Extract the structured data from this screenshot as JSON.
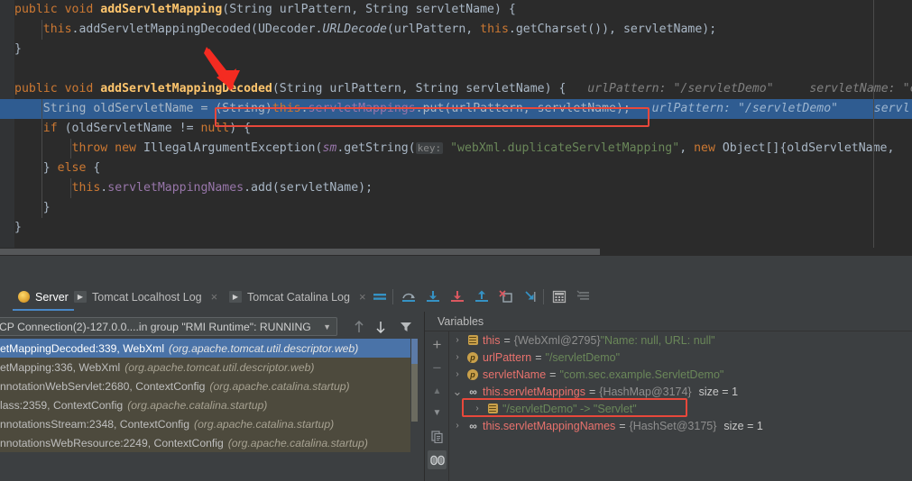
{
  "editor": {
    "lines": [
      {
        "id": "line-1",
        "tokens": [
          {
            "t": "public ",
            "c": "kw"
          },
          {
            "t": "void ",
            "c": "kw"
          },
          {
            "t": "addServletMapping",
            "c": "fn"
          },
          {
            "t": "(",
            "c": "plain"
          },
          {
            "t": "String",
            "c": "plain"
          },
          {
            "t": " urlPattern, ",
            "c": "plain"
          },
          {
            "t": "String",
            "c": "plain"
          },
          {
            "t": " servletName) {",
            "c": "plain"
          }
        ],
        "indent": 1
      },
      {
        "id": "line-2",
        "tokens": [
          {
            "t": "    ",
            "c": "plain"
          },
          {
            "t": "this",
            "c": "kw"
          },
          {
            "t": ".",
            "c": "plain"
          },
          {
            "t": "addServletMappingDecoded",
            "c": "plain"
          },
          {
            "t": "(UDecoder.",
            "c": "plain"
          },
          {
            "t": "URLDecode",
            "c": "static-it"
          },
          {
            "t": "(urlPattern, ",
            "c": "plain"
          },
          {
            "t": "this",
            "c": "kw"
          },
          {
            "t": ".getCharset()), servletName);",
            "c": "plain"
          }
        ],
        "indent": 2
      },
      {
        "id": "line-3",
        "tokens": [
          {
            "t": "}",
            "c": "plain"
          }
        ],
        "indent": 1
      },
      {
        "id": "line-4",
        "tokens": [
          {
            "t": "",
            "c": "plain"
          }
        ],
        "indent": 0
      },
      {
        "id": "line-5",
        "tokens": [
          {
            "t": "public ",
            "c": "kw"
          },
          {
            "t": "void ",
            "c": "kw"
          },
          {
            "t": "addServletMappingDecoded",
            "c": "fn"
          },
          {
            "t": "(",
            "c": "plain"
          },
          {
            "t": "String",
            "c": "plain"
          },
          {
            "t": " urlPattern, ",
            "c": "plain"
          },
          {
            "t": "String",
            "c": "plain"
          },
          {
            "t": " servletName) {",
            "c": "plain"
          },
          {
            "t": "   urlPattern: ",
            "c": "hint"
          },
          {
            "t": "\"/servletDemo\"",
            "c": "hint"
          },
          {
            "t": "     servletName: ",
            "c": "hint"
          },
          {
            "t": "\"c",
            "c": "hint"
          }
        ],
        "indent": 1
      },
      {
        "id": "line-6-current",
        "current": true,
        "tokens": [
          {
            "t": "    ",
            "c": "plain"
          },
          {
            "t": "String",
            "c": "plain"
          },
          {
            "t": " oldServletName = ",
            "c": "plain"
          },
          {
            "t": "(String)",
            "c": "plain"
          },
          {
            "t": "this",
            "c": "kw"
          },
          {
            "t": ".",
            "c": "plain"
          },
          {
            "t": "servletMappings",
            "c": "field"
          },
          {
            "t": ".put(urlPattern, servletName);",
            "c": "plain"
          },
          {
            "t": "   urlPattern: ",
            "c": "hint"
          },
          {
            "t": "\"/servletDemo\"",
            "c": "hint"
          },
          {
            "t": "     servl",
            "c": "hint"
          }
        ],
        "indent": 2
      },
      {
        "id": "line-7",
        "tokens": [
          {
            "t": "    ",
            "c": "plain"
          },
          {
            "t": "if",
            "c": "kw"
          },
          {
            "t": " (oldServletName != ",
            "c": "plain"
          },
          {
            "t": "null",
            "c": "kw"
          },
          {
            "t": ") {",
            "c": "plain"
          }
        ],
        "indent": 2
      },
      {
        "id": "line-8",
        "tokens": [
          {
            "t": "        ",
            "c": "plain"
          },
          {
            "t": "throw ",
            "c": "kw"
          },
          {
            "t": "new ",
            "c": "kw"
          },
          {
            "t": "IllegalArgumentException(",
            "c": "plain"
          },
          {
            "t": "sm",
            "c": "field-it"
          },
          {
            "t": ".getString(",
            "c": "plain"
          },
          {
            "t": "KEYHINT",
            "c": "keyhint-marker"
          },
          {
            "t": " \"webXml.duplicateServletMapping\"",
            "c": "str"
          },
          {
            "t": ", ",
            "c": "plain"
          },
          {
            "t": "new ",
            "c": "kw"
          },
          {
            "t": "Object[]{oldServletName,",
            "c": "plain"
          }
        ],
        "indent": 3
      },
      {
        "id": "line-9",
        "tokens": [
          {
            "t": "    } ",
            "c": "plain"
          },
          {
            "t": "else",
            "c": "kw"
          },
          {
            "t": " {",
            "c": "plain"
          }
        ],
        "indent": 2
      },
      {
        "id": "line-10",
        "tokens": [
          {
            "t": "        ",
            "c": "plain"
          },
          {
            "t": "this",
            "c": "kw"
          },
          {
            "t": ".",
            "c": "plain"
          },
          {
            "t": "servletMappingNames",
            "c": "field"
          },
          {
            "t": ".add(servletName);",
            "c": "plain"
          }
        ],
        "indent": 3
      },
      {
        "id": "line-11",
        "tokens": [
          {
            "t": "    }",
            "c": "plain"
          }
        ],
        "indent": 2
      },
      {
        "id": "line-12",
        "tokens": [
          {
            "t": "}",
            "c": "plain"
          }
        ],
        "indent": 1
      }
    ],
    "key_hint_label": "key:",
    "annotation": {
      "arrow_name": "red-annotation-arrow",
      "box_color": "#e8483b"
    }
  },
  "toolwindow": {
    "tabs": [
      {
        "id": "tab-server",
        "label": "Server",
        "icon": "tomcat-icon",
        "selected": true,
        "closable": false
      },
      {
        "id": "tab-tomcat-localhost-log",
        "label": "Tomcat Localhost Log",
        "icon": "run-icon",
        "selected": false,
        "closable": true
      },
      {
        "id": "tab-tomcat-catalina-log",
        "label": "Tomcat Catalina Log",
        "icon": "run-icon",
        "selected": false,
        "closable": true
      }
    ],
    "close_label": "×",
    "toolbar": [
      {
        "id": "show-execution-point-button",
        "icon": "show-execution-point-icon",
        "title": "Show Execution Point"
      },
      {
        "id": "step-over-button",
        "icon": "step-over-icon",
        "title": "Step Over"
      },
      {
        "id": "step-into-button",
        "icon": "step-into-icon",
        "title": "Step Into"
      },
      {
        "id": "force-step-into-button",
        "icon": "force-step-into-icon",
        "title": "Force Step Into"
      },
      {
        "id": "step-out-button",
        "icon": "step-out-icon",
        "title": "Step Out"
      },
      {
        "id": "drop-frame-button",
        "icon": "drop-frame-icon",
        "title": "Drop Frame"
      },
      {
        "id": "run-to-cursor-button",
        "icon": "run-to-cursor-icon",
        "title": "Run to Cursor"
      },
      {
        "id": "evaluate-expression-button",
        "icon": "calculator-icon",
        "title": "Evaluate Expression"
      },
      {
        "id": "mute-breakpoints-button",
        "icon": "mute-breakpoints-icon",
        "title": "Mute Breakpoints"
      }
    ]
  },
  "frames_pane": {
    "thread_selector": {
      "value": "CP Connection(2)-127.0.0....in group \"RMI Runtime\": RUNNING",
      "caret": "▼"
    },
    "buttons": [
      {
        "id": "frames-up-button",
        "icon": "arrow-up-icon",
        "glyph": "↑"
      },
      {
        "id": "frames-down-button",
        "icon": "arrow-down-icon",
        "glyph": "↓"
      },
      {
        "id": "frames-filter-button",
        "icon": "filter-icon",
        "glyph": "▼"
      }
    ],
    "frames": [
      {
        "id": "frame-0",
        "text": "etMappingDecoded:339, WebXml",
        "pkg": "(org.apache.tomcat.util.descriptor.web)",
        "state": "selected"
      },
      {
        "id": "frame-1",
        "text": "etMapping:336, WebXml",
        "pkg": "(org.apache.tomcat.util.descriptor.web)",
        "state": "context"
      },
      {
        "id": "frame-2",
        "text": "nnotationWebServlet:2680, ContextConfig",
        "pkg": "(org.apache.catalina.startup)",
        "state": "context"
      },
      {
        "id": "frame-3",
        "text": "lass:2359, ContextConfig",
        "pkg": "(org.apache.catalina.startup)",
        "state": "context"
      },
      {
        "id": "frame-4",
        "text": "nnotationsStream:2348, ContextConfig",
        "pkg": "(org.apache.catalina.startup)",
        "state": "context"
      },
      {
        "id": "frame-5",
        "text": "nnotationsWebResource:2249, ContextConfig",
        "pkg": "(org.apache.catalina.startup)",
        "state": "context"
      }
    ]
  },
  "variables_pane": {
    "title": "Variables",
    "left_toolbar": [
      {
        "id": "add-watch-button",
        "icon": "plus-icon",
        "glyph": "+",
        "active": false
      },
      {
        "id": "remove-watch-button",
        "icon": "minus-icon",
        "glyph": "−",
        "active": false
      },
      {
        "id": "move-watch-up-button",
        "icon": "triangle-up-icon",
        "glyph": "▲",
        "active": false
      },
      {
        "id": "move-watch-down-button",
        "icon": "triangle-down-icon",
        "glyph": "▼",
        "active": false
      },
      {
        "id": "copy-value-button",
        "icon": "copy-icon",
        "glyph": "❐",
        "active": false
      },
      {
        "id": "watches-toggle-button",
        "icon": "watches-icon",
        "glyph": "∞",
        "active": true
      }
    ],
    "rows": [
      {
        "id": "var-this",
        "indent": 0,
        "chevron": "›",
        "icon": "object-icon",
        "name": "this",
        "eq": "=",
        "type": "{WebXml@2795}",
        "value": "\"Name: null, URL: null\"",
        "size": "",
        "highlighted": false
      },
      {
        "id": "var-urlPattern",
        "indent": 0,
        "chevron": "›",
        "icon": "parameter-icon",
        "name": "urlPattern",
        "eq": "=",
        "type": "",
        "value": "\"/servletDemo\"",
        "size": "",
        "highlighted": false
      },
      {
        "id": "var-servletName",
        "indent": 0,
        "chevron": "›",
        "icon": "parameter-icon",
        "name": "servletName",
        "eq": "=",
        "type": "",
        "value": "\"com.sec.example.ServletDemo\"",
        "size": "",
        "highlighted": false
      },
      {
        "id": "var-servletMappings",
        "indent": 0,
        "chevron": "⌄",
        "icon": "watch-icon",
        "name": "this.servletMappings",
        "eq": "=",
        "type": "{HashMap@3174}",
        "value": "",
        "size": "size = 1",
        "highlighted": false
      },
      {
        "id": "var-servletMappings-entry",
        "indent": 1,
        "chevron": "›",
        "icon": "object-icon",
        "name": "",
        "eq": "",
        "type": "",
        "value": "\"/servletDemo\" -> \"Servlet\"",
        "size": "",
        "highlighted": true
      },
      {
        "id": "var-servletMappingNames",
        "indent": 0,
        "chevron": "›",
        "icon": "watch-icon",
        "name": "this.servletMappingNames",
        "eq": "=",
        "type": "{HashSet@3175}",
        "value": "",
        "size": "size = 1",
        "highlighted": false
      }
    ]
  },
  "colors": {
    "editor_bg": "#2b2b2b",
    "panel_bg": "#3c3f41",
    "current_line": "#2f5c91",
    "selection_blue": "#4a73a8",
    "annotation_red": "#e8483b",
    "keyword_orange": "#cc7832",
    "string_green": "#6a8759",
    "field_purple": "#9876aa",
    "method_yellow": "#ffc66d",
    "text_default": "#a9b7c6"
  }
}
